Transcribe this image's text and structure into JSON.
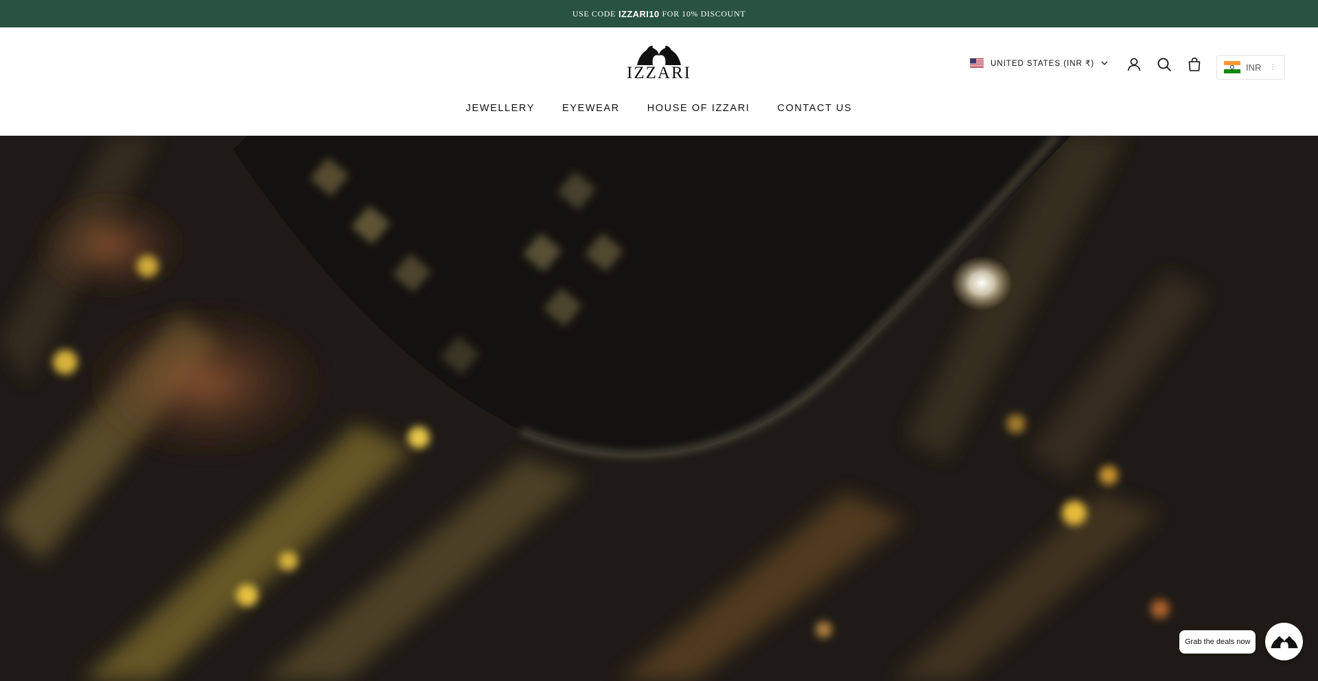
{
  "announcement": {
    "prefix": "USE CODE",
    "code": "IZZARI10",
    "suffix": "FOR 10% DISCOUNT"
  },
  "brand": {
    "name": "IZZARI",
    "accent_color": "#285341"
  },
  "nav": {
    "items": [
      {
        "label": "JEWELLERY"
      },
      {
        "label": "EYEWEAR"
      },
      {
        "label": "HOUSE OF IZZARI"
      },
      {
        "label": "CONTACT US"
      }
    ]
  },
  "header": {
    "region_label": "UNITED STATES (INR ₹)",
    "icons": [
      "account-icon",
      "search-icon",
      "cart-icon"
    ],
    "currency_label": "INR"
  },
  "floating": {
    "deals_label": "Grab the deals now"
  }
}
